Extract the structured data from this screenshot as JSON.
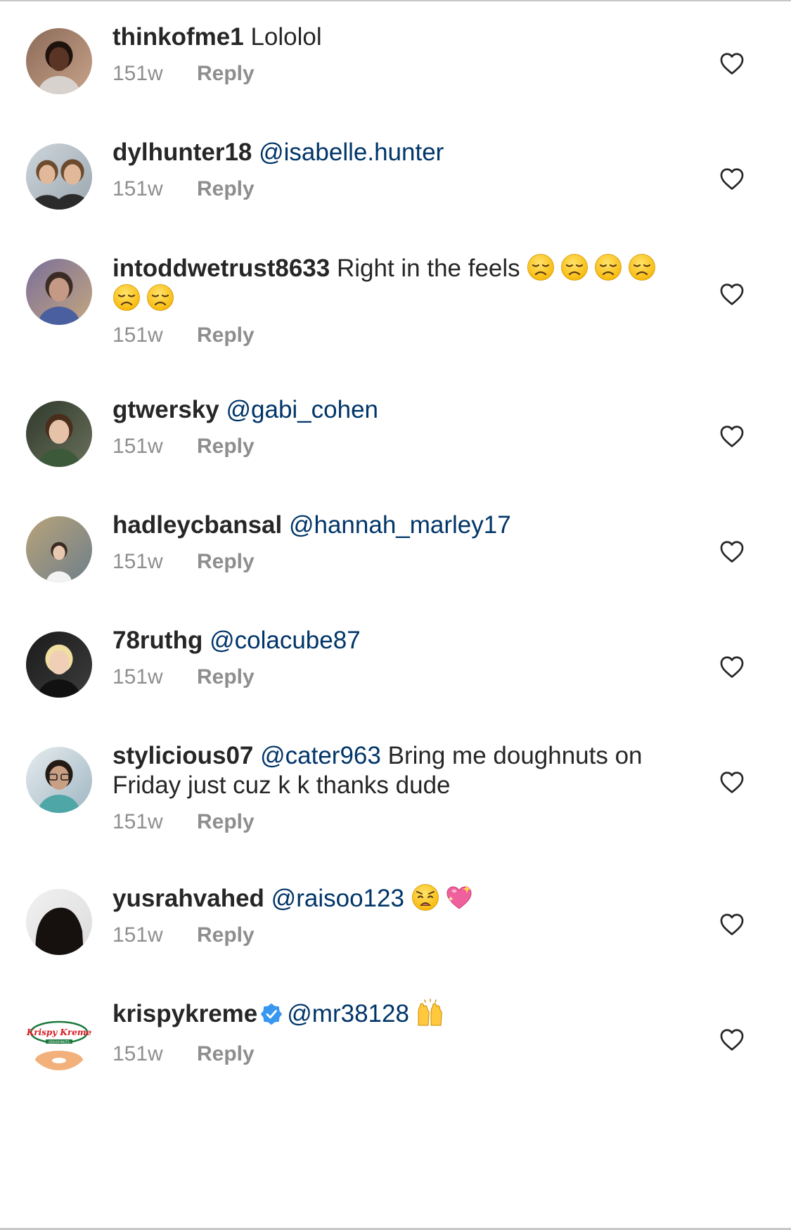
{
  "colors": {
    "text": "#262626",
    "mention": "#003569",
    "meta": "#8e8e8e",
    "divider": "#c7c7c7",
    "verified": "#3897f0"
  },
  "comments": [
    {
      "username": "thinkofme1",
      "segments": [
        {
          "type": "text",
          "text": "Lololol"
        }
      ],
      "time": "151w",
      "reply_label": "Reply",
      "avatar_icon": "profile-photo",
      "like_icon": "heart-outline-icon"
    },
    {
      "username": "dylhunter18",
      "segments": [
        {
          "type": "mention",
          "text": "@isabelle.hunter"
        }
      ],
      "time": "151w",
      "reply_label": "Reply",
      "avatar_icon": "profile-photo",
      "like_icon": "heart-outline-icon"
    },
    {
      "username": "intoddwetrust8633",
      "segments": [
        {
          "type": "text",
          "text": "Right in the feels"
        },
        {
          "type": "emoji",
          "emoji": "disappointed-face"
        },
        {
          "type": "emoji",
          "emoji": "disappointed-face"
        },
        {
          "type": "emoji",
          "emoji": "disappointed-face"
        },
        {
          "type": "emoji",
          "emoji": "disappointed-face"
        },
        {
          "type": "emoji",
          "emoji": "disappointed-face"
        },
        {
          "type": "emoji",
          "emoji": "disappointed-face"
        }
      ],
      "time": "151w",
      "reply_label": "Reply",
      "avatar_icon": "profile-photo",
      "like_icon": "heart-outline-icon"
    },
    {
      "username": "gtwersky",
      "segments": [
        {
          "type": "mention",
          "text": "@gabi_cohen"
        }
      ],
      "time": "151w",
      "reply_label": "Reply",
      "avatar_icon": "profile-photo",
      "like_icon": "heart-outline-icon"
    },
    {
      "username": "hadleycbansal",
      "segments": [
        {
          "type": "mention",
          "text": "@hannah_marley17"
        }
      ],
      "time": "151w",
      "reply_label": "Reply",
      "avatar_icon": "profile-photo",
      "like_icon": "heart-outline-icon"
    },
    {
      "username": "78ruthg",
      "segments": [
        {
          "type": "mention",
          "text": "@colacube87"
        }
      ],
      "time": "151w",
      "reply_label": "Reply",
      "avatar_icon": "profile-photo",
      "like_icon": "heart-outline-icon"
    },
    {
      "username": "stylicious07",
      "segments": [
        {
          "type": "mention",
          "text": "@cater963"
        },
        {
          "type": "text",
          "text": "Bring me doughnuts on Friday just cuz k k thanks dude"
        }
      ],
      "time": "151w",
      "reply_label": "Reply",
      "avatar_icon": "profile-photo",
      "like_icon": "heart-outline-icon"
    },
    {
      "username": "yusrahvahed",
      "segments": [
        {
          "type": "mention",
          "text": "@raisoo123"
        },
        {
          "type": "emoji",
          "emoji": "weary-face"
        },
        {
          "type": "emoji",
          "emoji": "sparkling-heart"
        }
      ],
      "time": "151w",
      "reply_label": "Reply",
      "avatar_icon": "profile-photo",
      "like_icon": "heart-outline-icon"
    },
    {
      "username": "krispykreme",
      "verified": true,
      "verified_icon": "verified-badge-icon",
      "segments": [
        {
          "type": "mention",
          "text": "@mr38128"
        },
        {
          "type": "emoji",
          "emoji": "raising-hands"
        }
      ],
      "time": "151w",
      "reply_label": "Reply",
      "avatar_icon": "krispy-kreme-logo",
      "avatar_logo_text": "Krispy Kreme",
      "avatar_logo_subtext": "DOUGHNUTS",
      "like_icon": "heart-outline-icon"
    }
  ]
}
